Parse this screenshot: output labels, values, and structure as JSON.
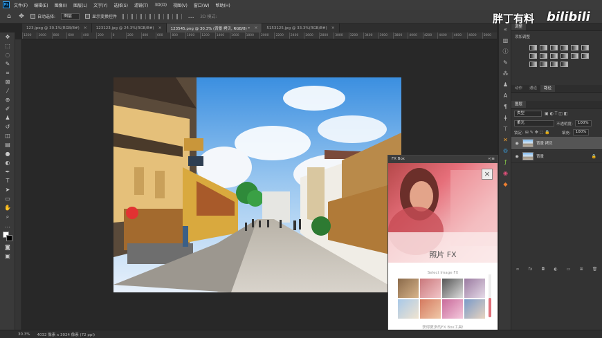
{
  "menubar": {
    "logo": "Ps",
    "items": [
      "文件(F)",
      "编辑(E)",
      "图像(I)",
      "图层(L)",
      "文字(Y)",
      "选择(S)",
      "滤镜(T)",
      "3D(D)",
      "视图(V)",
      "窗口(W)",
      "帮助(H)"
    ]
  },
  "options": {
    "auto_select_label": "自动选择:",
    "auto_select_value": "图层",
    "show_transform_label": "显示变换控件",
    "mode_3d": "3D 模式:"
  },
  "tabs": [
    {
      "label": "123.jpeg @ 30.1%(RGB/8#)",
      "close": "×"
    },
    {
      "label": "123123.jpg @ 24.3%(RGB/8#)",
      "close": "×"
    },
    {
      "label": "123545.png @ 30.3% (背景 拷贝, RGB/8) *",
      "close": "×"
    },
    {
      "label": "5153125.jpg @ 33.3%(RGB/8#)",
      "close": "×"
    }
  ],
  "ruler_ticks": [
    "1200",
    "1000",
    "800",
    "600",
    "400",
    "200",
    "0",
    "200",
    "400",
    "600",
    "800",
    "1000",
    "1200",
    "1400",
    "1600",
    "1800",
    "2000",
    "2200",
    "2400",
    "2600",
    "2800",
    "3000",
    "3200",
    "3400",
    "3600",
    "3800",
    "4000",
    "4200",
    "4400",
    "4600",
    "4800",
    "5000"
  ],
  "status": {
    "zoom": "30.3%",
    "doc_info": "4032 像素 x 3024 像素 (72 ppi)"
  },
  "adjustments_panel": {
    "tab": "调整",
    "add_label": "添加调整"
  },
  "mid_tabs": [
    "动作",
    "通道",
    "路径"
  ],
  "layers_panel": {
    "tab": "图层",
    "kind": "类型",
    "blend": "柔光",
    "opacity_label": "不透明度:",
    "opacity": "100%",
    "lock_label": "锁定:",
    "fill_label": "填充:",
    "fill": "100%",
    "layers": [
      {
        "name": "背景 拷贝",
        "selected": true
      },
      {
        "name": "背景",
        "selected": false
      }
    ]
  },
  "fxbox": {
    "title": "FX Box",
    "title_controls": "»|≡",
    "close": "×",
    "heading": "照片 FX",
    "select_label": "Select Image FX",
    "footer": "获得更多的FX Box工具!"
  },
  "watermark": {
    "text": "胖丁有料",
    "logo": "bilibili"
  },
  "colors": {
    "accent": "#31a8ff",
    "fx_pink": "#e0707a"
  }
}
